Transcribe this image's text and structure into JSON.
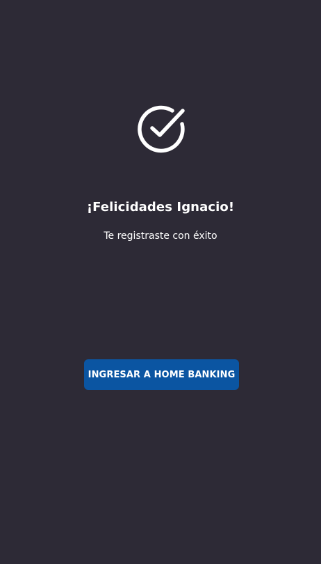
{
  "success_screen": {
    "icon": "check-circle-icon",
    "title": "¡Felicidades Ignacio!",
    "subtitle": "Te registraste con éxito",
    "button_label": "INGRESAR A HOME BANKING"
  },
  "colors": {
    "background": "#2d2a36",
    "text": "#ffffff",
    "button_background": "#0b55a2"
  }
}
